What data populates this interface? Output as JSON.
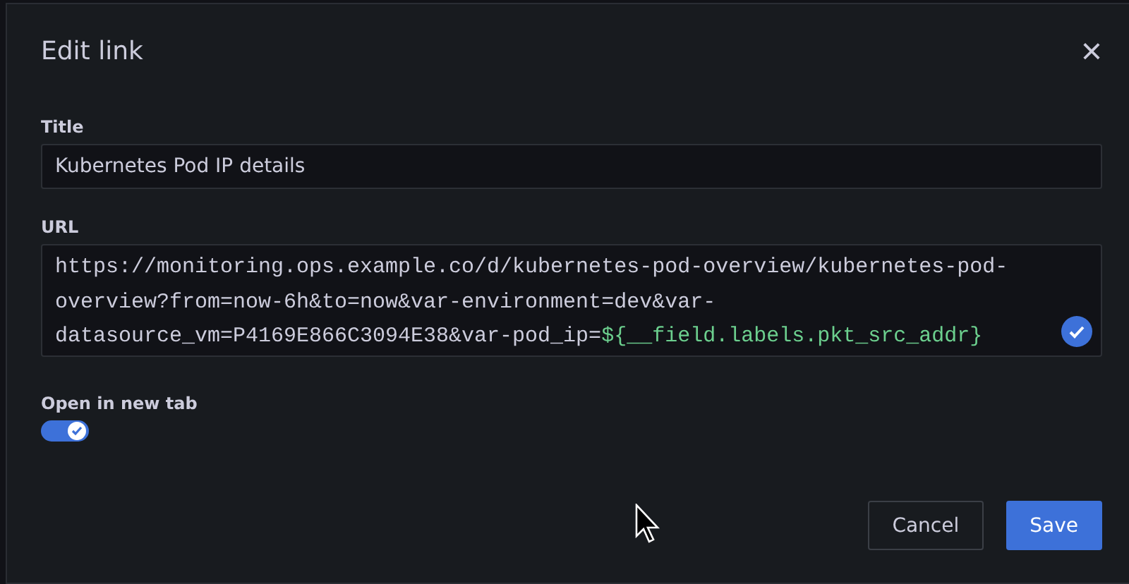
{
  "dialog": {
    "title": "Edit link",
    "close": "×"
  },
  "title_field": {
    "label": "Title",
    "value": "Kubernetes Pod IP details"
  },
  "url_field": {
    "label": "URL",
    "valid": true,
    "parts": [
      {
        "kind": "plain",
        "text": "https://monitoring.ops.example.co/d/kubernetes-pod-overview/kubernetes-pod-overview?from=now-6h&to=now&var-environment=dev&var-datasource_vm=P4169E866C3094E38&var-pod_ip="
      },
      {
        "kind": "variable",
        "text": "${__field.labels.pkt_src_addr}"
      }
    ]
  },
  "new_tab": {
    "label": "Open in new tab",
    "on": true
  },
  "buttons": [
    {
      "kind": "secondary",
      "label": "Cancel"
    },
    {
      "kind": "primary",
      "label": "Save"
    }
  ]
}
